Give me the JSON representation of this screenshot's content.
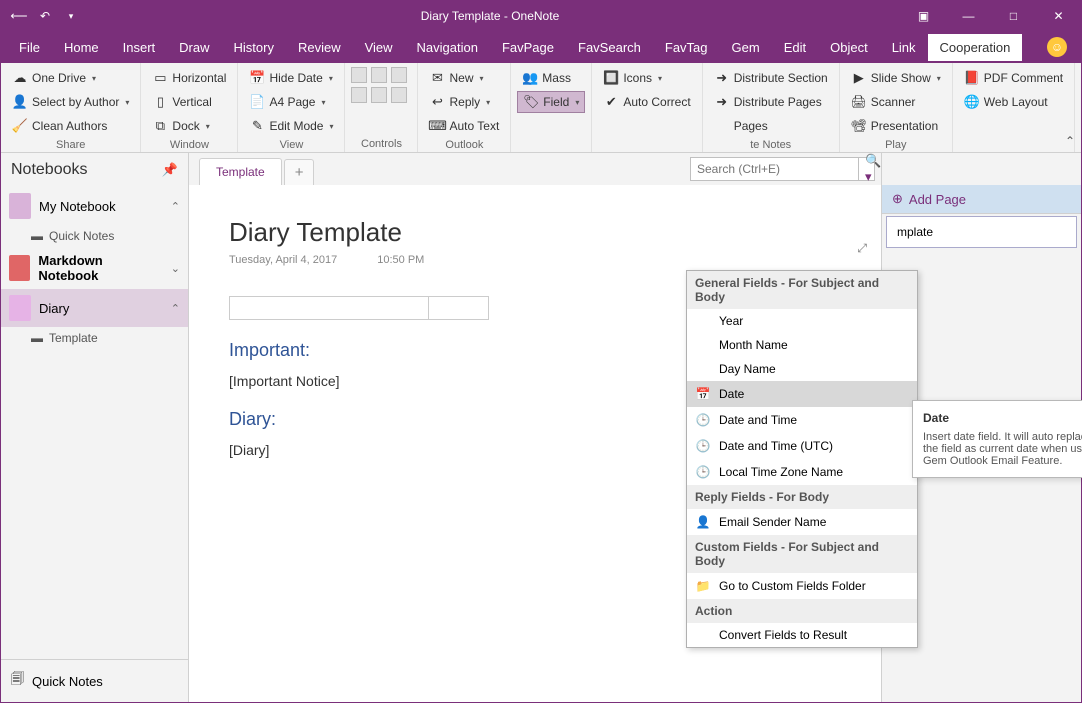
{
  "titlebar": {
    "title": "Diary Template  -  OneNote"
  },
  "menubar": [
    "File",
    "Home",
    "Insert",
    "Draw",
    "History",
    "Review",
    "View",
    "Navigation",
    "FavPage",
    "FavSearch",
    "FavTag",
    "Gem",
    "Edit",
    "Object",
    "Link",
    "Cooperation"
  ],
  "menubar_active": 15,
  "ribbon": {
    "groups": [
      {
        "label": "Share",
        "buttons": [
          {
            "icon": "☁",
            "text": "One Drive",
            "dd": true
          },
          {
            "icon": "👤",
            "text": "Select by Author",
            "dd": true
          },
          {
            "icon": "🧹",
            "text": "Clean Authors"
          }
        ]
      },
      {
        "label": "Window",
        "buttons": [
          {
            "icon": "▭",
            "text": "Horizontal"
          },
          {
            "icon": "▯",
            "text": "Vertical"
          },
          {
            "icon": "⧉",
            "text": "Dock",
            "dd": true
          }
        ]
      },
      {
        "label": "View",
        "buttons": [
          {
            "icon": "📅",
            "text": "Hide Date",
            "dd": true
          },
          {
            "icon": "📄",
            "text": "A4 Page",
            "dd": true
          },
          {
            "icon": "✎",
            "text": "Edit Mode",
            "dd": true
          }
        ]
      },
      {
        "label": "Controls",
        "controls": true
      },
      {
        "label": "Outlook",
        "buttons": [
          {
            "icon": "✉",
            "text": "New",
            "dd": true
          },
          {
            "icon": "↩",
            "text": "Reply",
            "dd": true
          },
          {
            "icon": "⌨",
            "text": "Auto Text"
          }
        ]
      },
      {
        "label": "",
        "buttons": [
          {
            "icon": "👥",
            "text": "Mass"
          },
          {
            "icon": "🏷",
            "text": "Field",
            "dd": true,
            "active": true
          },
          {
            "icon": "",
            "text": ""
          }
        ]
      },
      {
        "label": "",
        "buttons": [
          {
            "icon": "🔲",
            "text": "Icons",
            "dd": true
          },
          {
            "icon": "✔",
            "text": "Auto Correct"
          },
          {
            "icon": "",
            "text": ""
          }
        ]
      },
      {
        "label": "te Notes",
        "buttons": [
          {
            "icon": "➜",
            "text": "Distribute Section"
          },
          {
            "icon": "➜",
            "text": "Distribute Pages"
          },
          {
            "icon": "",
            "text": "Pages"
          }
        ]
      },
      {
        "label": "Play",
        "buttons": [
          {
            "icon": "▶",
            "text": "Slide Show",
            "dd": true
          },
          {
            "icon": "🖨",
            "text": "Scanner"
          },
          {
            "icon": "📽",
            "text": "Presentation"
          }
        ]
      },
      {
        "label": "",
        "buttons": [
          {
            "icon": "📕",
            "text": "PDF Comment"
          },
          {
            "icon": "🌐",
            "text": "Web Layout"
          },
          {
            "icon": "",
            "text": ""
          }
        ]
      }
    ]
  },
  "sidebar": {
    "title": "Notebooks",
    "notebooks": [
      {
        "color": "#d9b3d9",
        "name": "My Notebook",
        "expanded": true,
        "children": [
          {
            "name": "Quick Notes"
          }
        ]
      },
      {
        "color": "#e06666",
        "name": "Markdown Notebook",
        "expanded": false,
        "bold": true,
        "children": []
      },
      {
        "color": "#e6b3e6",
        "name": "Diary",
        "expanded": true,
        "selected": true,
        "children": [
          {
            "name": "Template"
          }
        ]
      }
    ],
    "footer": "Quick Notes"
  },
  "tabs": [
    {
      "label": "Template"
    }
  ],
  "search_placeholder": "Search (Ctrl+E)",
  "page": {
    "title": "Diary Template",
    "date": "Tuesday, April 4, 2017",
    "time": "10:50 PM",
    "sections": [
      {
        "heading": "Important:",
        "text": "[Important Notice]"
      },
      {
        "heading": "Diary:",
        "text": "[Diary]"
      }
    ]
  },
  "pages_pane": {
    "add": "Add Page",
    "items": [
      "mplate"
    ]
  },
  "field_menu": {
    "sections": [
      {
        "header": "General Fields - For Subject and Body",
        "items": [
          {
            "label": "Year"
          },
          {
            "label": "Month Name"
          },
          {
            "label": "Day Name"
          },
          {
            "label": "Date",
            "icon": "📅",
            "hl": true
          },
          {
            "label": "Date and Time",
            "icon": "🕒"
          },
          {
            "label": "Date and Time (UTC)",
            "icon": "🕒"
          },
          {
            "label": "Local Time Zone Name",
            "icon": "🕒"
          }
        ]
      },
      {
        "header": "Reply Fields - For Body",
        "items": [
          {
            "label": "Email Sender Name",
            "icon": "👤"
          }
        ]
      },
      {
        "header": "Custom Fields - For Subject and Body",
        "items": [
          {
            "label": "Go to Custom Fields Folder",
            "icon": "📁"
          }
        ]
      },
      {
        "header": "Action",
        "items": [
          {
            "label": "Convert Fields to Result"
          }
        ]
      }
    ]
  },
  "tooltip": {
    "title": "Date",
    "body": "Insert date field. It will auto replace the field as current date when using Gem Outlook Email Feature."
  }
}
